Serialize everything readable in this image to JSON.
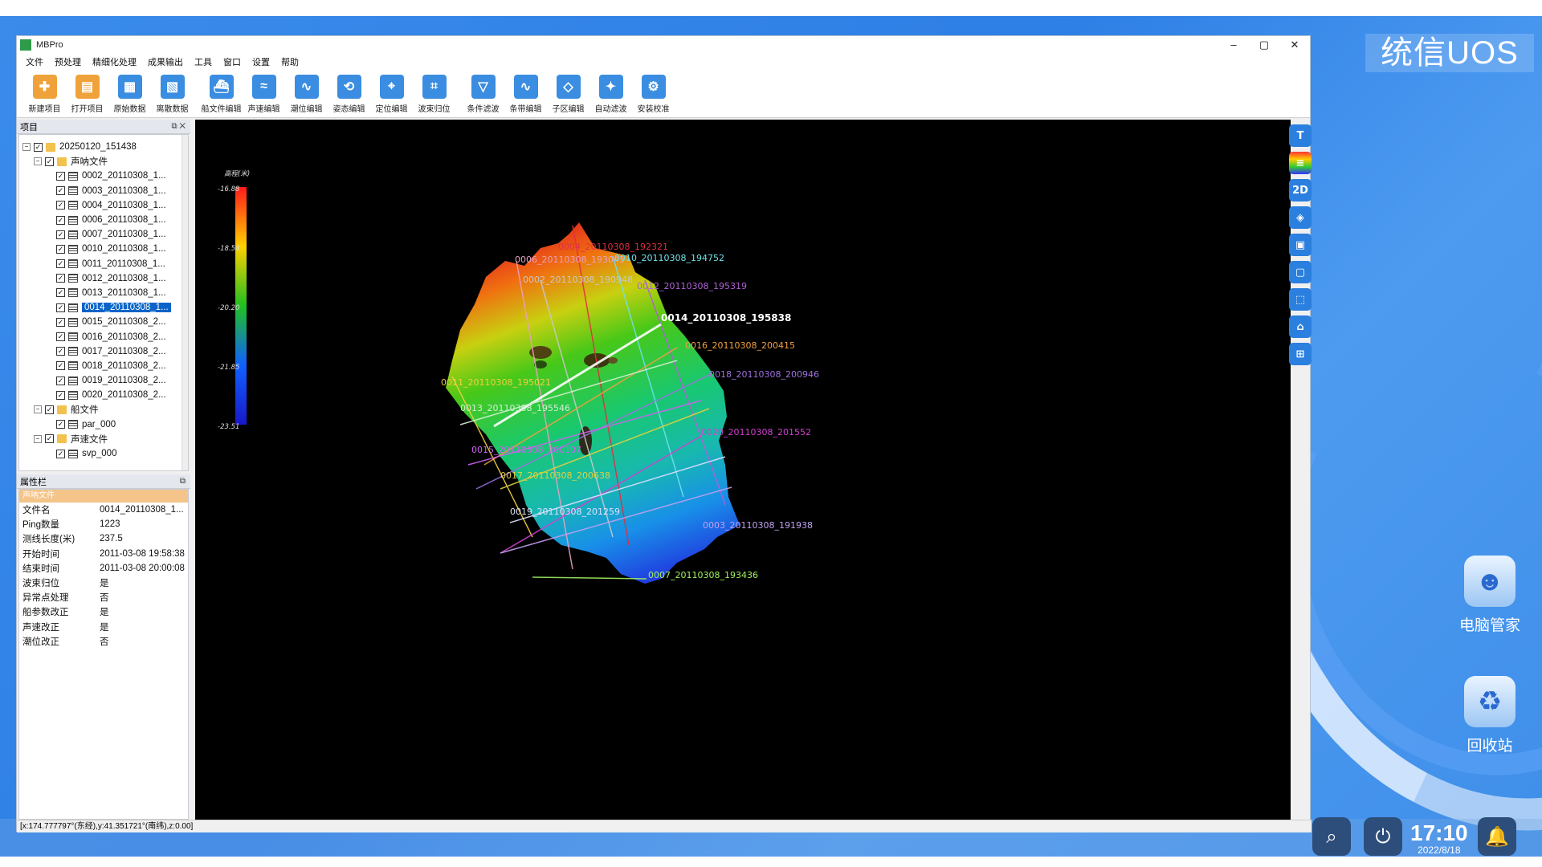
{
  "desktop": {
    "logo": "统信UOS",
    "icons": [
      {
        "label": "电脑管家",
        "icon": "robot-icon"
      },
      {
        "label": "回收站",
        "icon": "trash-icon"
      }
    ],
    "clock": {
      "time": "17:10",
      "date": "2022/8/18"
    }
  },
  "window": {
    "title": "MBPro",
    "controls": [
      "–",
      "▢",
      "✕"
    ],
    "menu": [
      "文件",
      "预处理",
      "精细化处理",
      "成果输出",
      "工具",
      "窗口",
      "设置",
      "帮助"
    ],
    "toolbar": [
      {
        "label": "新建项目",
        "color": "#f0a23a"
      },
      {
        "label": "打开项目",
        "color": "#f0a23a"
      },
      {
        "label": "原始数据",
        "color": "#3a8de0"
      },
      {
        "label": "离散数据",
        "color": "#3a8de0"
      },
      {
        "label": "船文件编辑",
        "color": "#3a8de0"
      },
      {
        "label": "声速编辑",
        "color": "#3a8de0"
      },
      {
        "label": "潮位编辑",
        "color": "#3a8de0"
      },
      {
        "label": "姿态编辑",
        "color": "#3a8de0"
      },
      {
        "label": "定位编辑",
        "color": "#3a8de0"
      },
      {
        "label": "波束归位",
        "color": "#3a8de0"
      },
      {
        "label": "条件滤波",
        "color": "#3a8de0"
      },
      {
        "label": "条带编辑",
        "color": "#3a8de0"
      },
      {
        "label": "子区编辑",
        "color": "#3a8de0"
      },
      {
        "label": "自动滤波",
        "color": "#3a8de0"
      },
      {
        "label": "安装校准",
        "color": "#3a8de0"
      }
    ]
  },
  "project_panel": {
    "title": "项目",
    "root": "20250120_151438",
    "sonar_folder": "声呐文件",
    "sonar_files": [
      "0002_20110308_1...",
      "0003_20110308_1...",
      "0004_20110308_1...",
      "0006_20110308_1...",
      "0007_20110308_1...",
      "0010_20110308_1...",
      "0011_20110308_1...",
      "0012_20110308_1...",
      "0013_20110308_1...",
      "0014_20110308_1...",
      "0015_20110308_2...",
      "0016_20110308_2...",
      "0017_20110308_2...",
      "0018_20110308_2...",
      "0019_20110308_2...",
      "0020_20110308_2..."
    ],
    "selected_index": 9,
    "ship_folder": "船文件",
    "ship_file": "par_000",
    "svp_folder": "声速文件",
    "svp_file": "svp_000"
  },
  "props_panel": {
    "title": "属性栏",
    "section": "声呐文件",
    "rows": [
      {
        "k": "文件名",
        "v": "0014_20110308_1..."
      },
      {
        "k": "Ping数量",
        "v": "1223"
      },
      {
        "k": "测线长度(米)",
        "v": "237.5"
      },
      {
        "k": "开始时间",
        "v": "2011-03-08 19:58:38"
      },
      {
        "k": "结束时间",
        "v": "2011-03-08 20:00:08"
      },
      {
        "k": "波束归位",
        "v": "是"
      },
      {
        "k": "异常点处理",
        "v": "否"
      },
      {
        "k": "船参数改正",
        "v": "是"
      },
      {
        "k": "声速改正",
        "v": "是"
      },
      {
        "k": "潮位改正",
        "v": "否"
      }
    ]
  },
  "legend": {
    "title": "高程(米)",
    "ticks": [
      "-16.88",
      "-18.54",
      "-20.20",
      "-21.85",
      "-23.51"
    ]
  },
  "lines": [
    {
      "label": "0004_20110308_192321",
      "color": "#e03040"
    },
    {
      "label": "0006_20110308_193043",
      "color": "#e8a0c0"
    },
    {
      "label": "0010_20110308_194752",
      "color": "#70e0e8"
    },
    {
      "label": "0002_20110308_190948",
      "color": "#c8c8c8"
    },
    {
      "label": "0012_20110308_195319",
      "color": "#b060d8"
    },
    {
      "label": "0014_20110308_195838",
      "color": "#ffffff"
    },
    {
      "label": "0016_20110308_200415",
      "color": "#f0a040"
    },
    {
      "label": "0018_20110308_200946",
      "color": "#a070e0"
    },
    {
      "label": "0011_20110308_195021",
      "color": "#f0d040"
    },
    {
      "label": "0013_20110308_195546",
      "color": "#d0f0d0"
    },
    {
      "label": "0020_20110308_201552",
      "color": "#d040d0"
    },
    {
      "label": "0015_20110308_200107",
      "color": "#d060f0"
    },
    {
      "label": "0017_20110308_200638",
      "color": "#e0d040"
    },
    {
      "label": "0019_20110308_201259",
      "color": "#e0e0ff"
    },
    {
      "label": "0003_20110308_191938",
      "color": "#c0a0f0"
    },
    {
      "label": "0007_20110308_193436",
      "color": "#a0f060"
    }
  ],
  "statusbar": "[x:174.777797°(东经),y:41.351721°(南纬),z:0.00]",
  "right_tools": [
    "T",
    "≡",
    "2D",
    "◈",
    "▣",
    "▢",
    "⬚",
    "⌂",
    "⊞"
  ]
}
